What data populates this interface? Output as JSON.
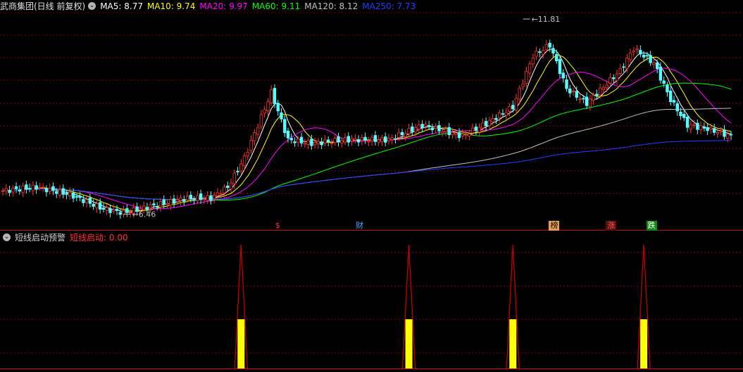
{
  "header": {
    "title": "武商集团(日线 前复权)",
    "ma": [
      {
        "label": "MA5: 8.77",
        "color": "#ffffff"
      },
      {
        "label": "MA10: 9.74",
        "color": "#ffff00"
      },
      {
        "label": "MA20: 9.97",
        "color": "#ff00ff"
      },
      {
        "label": "MA60: 9.11",
        "color": "#00ff00"
      },
      {
        "label": "MA120: 8.12",
        "color": "#c0c0c0"
      },
      {
        "label": "MA250: 7.73",
        "color": "#2040ff"
      }
    ]
  },
  "indicator": {
    "name": "短线启动预警",
    "value_label": "短线启动: 0.00"
  },
  "tags": [
    {
      "text": "$",
      "color": "#ff3030",
      "bg": "none"
    },
    {
      "text": "财",
      "color": "#4da6ff",
      "bg": "none"
    },
    {
      "text": "榜",
      "color": "#000000",
      "bg": "#e8a050"
    },
    {
      "text": "涨",
      "color": "#ff5050",
      "bg": "#5a1010"
    },
    {
      "text": "跌",
      "color": "#ffffff",
      "bg": "#118811"
    }
  ],
  "colors": {
    "up": "#ff3232",
    "down": "#54ffff",
    "grid": "#8b0000",
    "signal_line": "#c00000",
    "signal_fill": "#ffff00"
  },
  "chart_data": [
    {
      "type": "candlestick",
      "title": "武商集团(日线 前复权)",
      "ylim": [
        6.2,
        12.1
      ],
      "annotations": [
        {
          "text": "6.46",
          "kind": "low",
          "index": 36,
          "value": 6.46
        },
        {
          "text": "11.81",
          "kind": "high",
          "index": 155,
          "value": 11.81
        }
      ],
      "anchors": {
        "index": [
          0,
          10,
          20,
          25,
          30,
          36,
          45,
          55,
          62,
          67,
          72,
          80,
          85,
          92,
          102,
          115,
          125,
          137,
          145,
          152,
          158,
          163,
          168,
          174,
          184,
          188,
          194,
          199,
          204,
          210,
          217
        ],
        "close": [
          7.1,
          7.2,
          7.0,
          6.8,
          6.6,
          6.5,
          6.7,
          6.9,
          6.9,
          7.2,
          8.0,
          9.8,
          8.5,
          8.4,
          8.5,
          8.5,
          8.9,
          8.6,
          9.0,
          9.4,
          10.8,
          11.1,
          9.9,
          9.5,
          10.4,
          11.0,
          10.6,
          9.6,
          8.9,
          8.8,
          8.6
        ]
      },
      "series": [
        {
          "name": "MA5",
          "value": 8.77,
          "color": "#ffffff"
        },
        {
          "name": "MA10",
          "value": 9.74,
          "color": "#ffff00"
        },
        {
          "name": "MA20",
          "value": 9.97,
          "color": "#ff00ff"
        },
        {
          "name": "MA60",
          "value": 9.11,
          "color": "#00ff00"
        },
        {
          "name": "MA120",
          "value": 8.12,
          "color": "#c0c0c0"
        },
        {
          "name": "MA250",
          "value": 7.73,
          "color": "#2040ff"
        }
      ]
    },
    {
      "type": "bar",
      "title": "短线启动预警",
      "series": [
        {
          "name": "短线启动",
          "current": 0.0
        }
      ],
      "signal_indices": [
        71,
        121,
        152,
        191
      ],
      "ylim": [
        0,
        1
      ]
    }
  ]
}
